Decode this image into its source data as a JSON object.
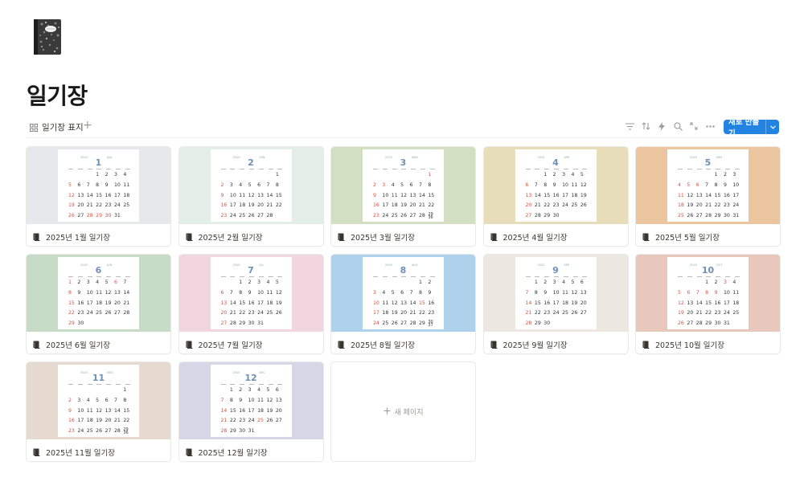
{
  "page": {
    "title": "일기장",
    "icon": "notebook-icon"
  },
  "toolbar": {
    "view_label": "일기장 표지",
    "add_view": "+",
    "icons": [
      "filter-icon",
      "sort-icon",
      "lightning-icon",
      "search-icon",
      "expand-icon",
      "more-icon"
    ],
    "new_button": "새로 만들기",
    "accent": "#2383e2"
  },
  "cards": [
    {
      "title": "2025년 1월 일기장",
      "month": "1",
      "mname": "JAN",
      "cover": "#e7e8ec",
      "lead": 3,
      "days": 31,
      "red": [
        5,
        12,
        19,
        26,
        28,
        29,
        30
      ]
    },
    {
      "title": "2025년 2월 일기장",
      "month": "2",
      "mname": "FEB",
      "cover": "#e3eee9",
      "lead": 6,
      "days": 28,
      "red": [
        2,
        9,
        16,
        23
      ]
    },
    {
      "title": "2025년 3월 일기장",
      "month": "3",
      "mname": "MAR",
      "cover": "#d2dfc2",
      "lead": 6,
      "days": 31,
      "red": [
        1,
        2,
        3,
        9,
        16,
        23,
        30
      ]
    },
    {
      "title": "2025년 4월 일기장",
      "month": "4",
      "mname": "APR",
      "cover": "#e8ddb9",
      "lead": 2,
      "days": 30,
      "red": [
        6,
        13,
        20,
        27
      ]
    },
    {
      "title": "2025년 5월 일기장",
      "month": "5",
      "mname": "MAY",
      "cover": "#ebc59d",
      "lead": 4,
      "days": 31,
      "red": [
        4,
        5,
        6,
        11,
        18,
        25
      ]
    },
    {
      "title": "2025년 6월 일기장",
      "month": "6",
      "mname": "JUN",
      "cover": "#c6dcc7",
      "lead": 0,
      "days": 30,
      "red": [
        1,
        6,
        8,
        15,
        22,
        29
      ]
    },
    {
      "title": "2025년 7월 일기장",
      "month": "7",
      "mname": "JUL",
      "cover": "#f1d6e0",
      "lead": 2,
      "days": 31,
      "red": [
        6,
        13,
        20,
        27
      ]
    },
    {
      "title": "2025년 8월 일기장",
      "month": "8",
      "mname": "AUG",
      "cover": "#aed2ec",
      "lead": 5,
      "days": 31,
      "red": [
        3,
        10,
        15,
        17,
        24,
        31
      ]
    },
    {
      "title": "2025년 9월 일기장",
      "month": "9",
      "mname": "SEP",
      "cover": "#ede7e2",
      "lead": 1,
      "days": 30,
      "red": [
        7,
        14,
        21,
        28
      ]
    },
    {
      "title": "2025년 10월 일기장",
      "month": "10",
      "mname": "OCT",
      "cover": "#e8c8bd",
      "lead": 3,
      "days": 31,
      "red": [
        3,
        5,
        6,
        7,
        8,
        9,
        12,
        19,
        26
      ]
    },
    {
      "title": "2025년 11월 일기장",
      "month": "11",
      "mname": "NOV",
      "cover": "#e5d9d0",
      "lead": 6,
      "days": 30,
      "red": [
        2,
        9,
        16,
        23,
        30
      ]
    },
    {
      "title": "2025년 12월 일기장",
      "month": "12",
      "mname": "DEC",
      "cover": "#d6d6e6",
      "lead": 1,
      "days": 31,
      "red": [
        7,
        14,
        21,
        25,
        28
      ]
    }
  ],
  "calendar": {
    "year": "2025"
  },
  "new_page": {
    "label": "새 페이지",
    "icon": "plus-icon"
  }
}
